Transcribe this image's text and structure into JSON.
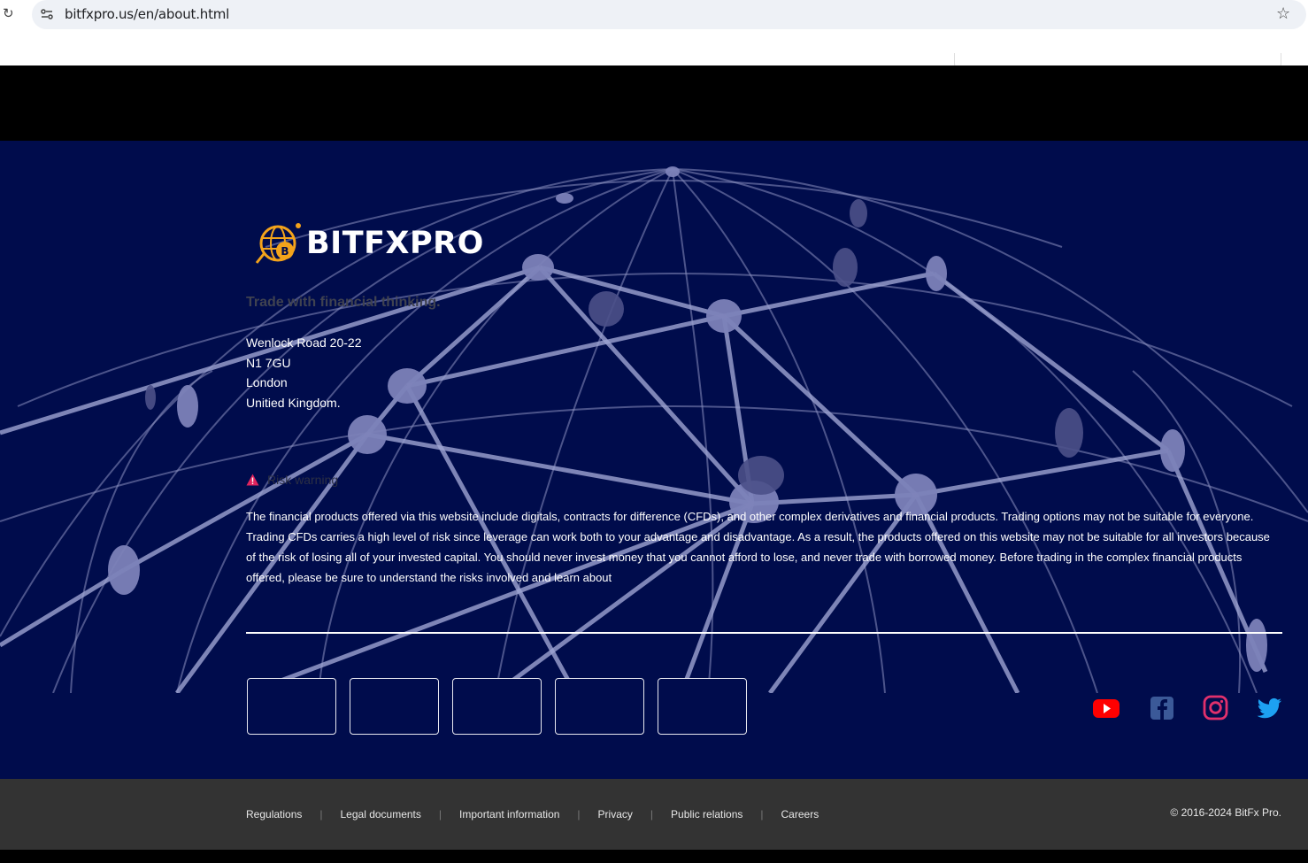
{
  "browser": {
    "url": "bitfxpro.us/en/about.html"
  },
  "footer": {
    "brand_name": "BITFXPRO",
    "tagline": "Trade with financial thinking.",
    "address": [
      "Wenlock Road 20-22",
      "N1 7GU",
      "London",
      "Unitied Kingdom."
    ],
    "risk_warning_title": "Risk warning",
    "risk_warning_text": "The financial products offered via this website include digitals, contracts for difference (CFDs), and other complex derivatives and financial products. Trading options may not be suitable for everyone. Trading CFDs carries a high level of risk since leverage can work both to your advantage and disadvantage. As a result, the products offered on this website may not be suitable for all investors because of the risk of losing all of your invested capital. You should never invest money that you cannot afford to lose, and never trade with borrowed money. Before trading in the complex financial products offered, please be sure to understand the risks involved and learn about",
    "social": [
      "youtube-icon",
      "facebook-icon",
      "instagram-icon",
      "twitter-icon"
    ],
    "colors": {
      "background": "#000c4c",
      "youtube": "#ff0000",
      "facebook": "#3b5998",
      "instagram": "#e1306c",
      "twitter": "#1da1f2",
      "warning": "#e0245e"
    }
  },
  "bottom_bar": {
    "links": [
      "Regulations",
      "Legal documents",
      "Important information",
      "Privacy",
      "Public relations",
      "Careers"
    ],
    "copyright": "© 2016-2024 BitFx Pro."
  }
}
